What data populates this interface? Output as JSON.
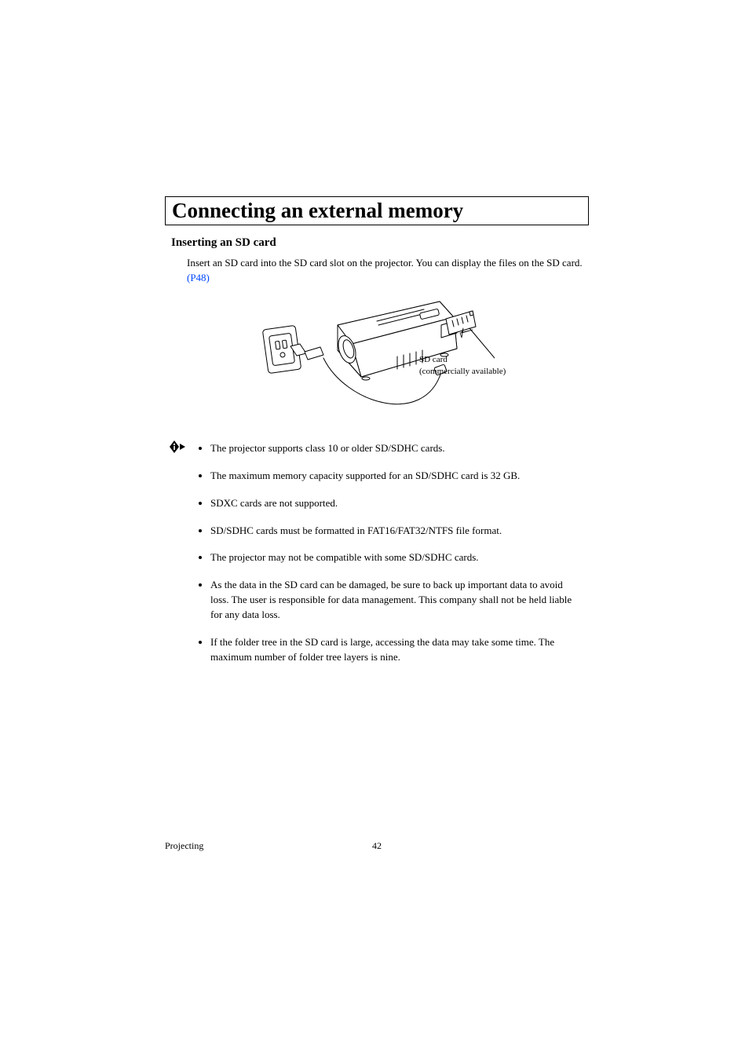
{
  "title": "Connecting an external memory",
  "subhead": "Inserting an SD card",
  "intro_prefix": "Insert an SD card into the SD card slot on the projector. You can display the files on the SD card. ",
  "intro_link": "(P48)",
  "figure_label_line1": "SD card",
  "figure_label_line2": "(commercially available)",
  "notes": [
    "The projector supports class 10 or older SD/SDHC cards.",
    "The maximum memory capacity supported for an SD/SDHC card is 32 GB.",
    "SDXC cards are not supported.",
    "SD/SDHC cards must be formatted in FAT16/FAT32/NTFS file format.",
    "The projector may not be compatible with some SD/SDHC cards.",
    "As the data in the SD card can be damaged, be sure to back up important data to avoid loss. The user is responsible for data management. This company shall not be held liable for any data loss.",
    "If the folder tree in the SD card is large, accessing the data may take some time. The maximum number of folder tree layers is nine."
  ],
  "footer_section": "Projecting",
  "footer_page": "42"
}
